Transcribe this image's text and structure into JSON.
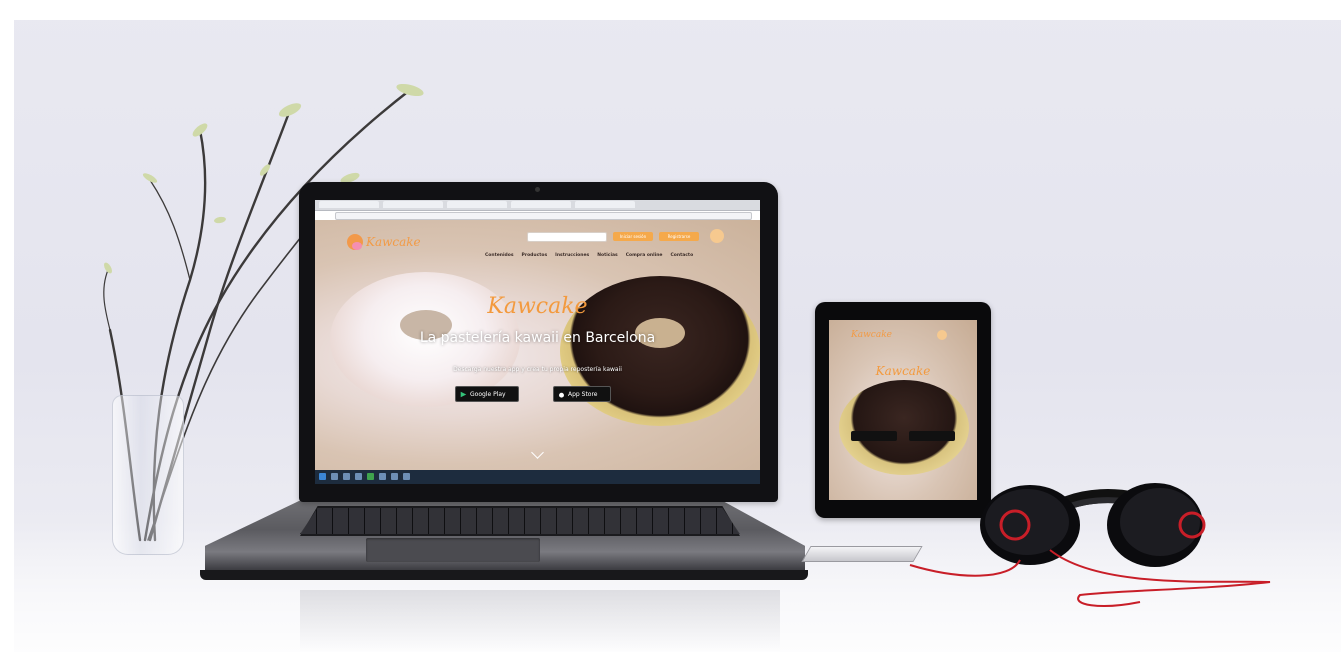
{
  "scene": {
    "laptop_site": {
      "logo_text": "Kawcake",
      "hero_title": "Kawcake",
      "hero_subtitle": "La pastelería kawaii en Barcelona",
      "hero_small": "Descarga nuestra app y crea tu propia repostería kawaii",
      "store_google": "Google Play",
      "store_apple": "App Store",
      "nav": [
        "Contenidos",
        "Productos",
        "Instrucciones",
        "Noticias",
        "Compra online",
        "Contacto"
      ],
      "buttons": [
        "Iniciar sesión",
        "Registrarse"
      ]
    },
    "tablet_site": {
      "logo_text": "Kawcake",
      "hero_title": "Kawcake"
    }
  },
  "icons": [
    "laptop-icon",
    "tablet-icon",
    "headphones-icon",
    "plant-vase-icon",
    "cart-icon",
    "search-icon"
  ],
  "colors": {
    "brand_orange": "#f39a3e",
    "background": "#e6e6ef",
    "headphone_red": "#c81e28"
  }
}
